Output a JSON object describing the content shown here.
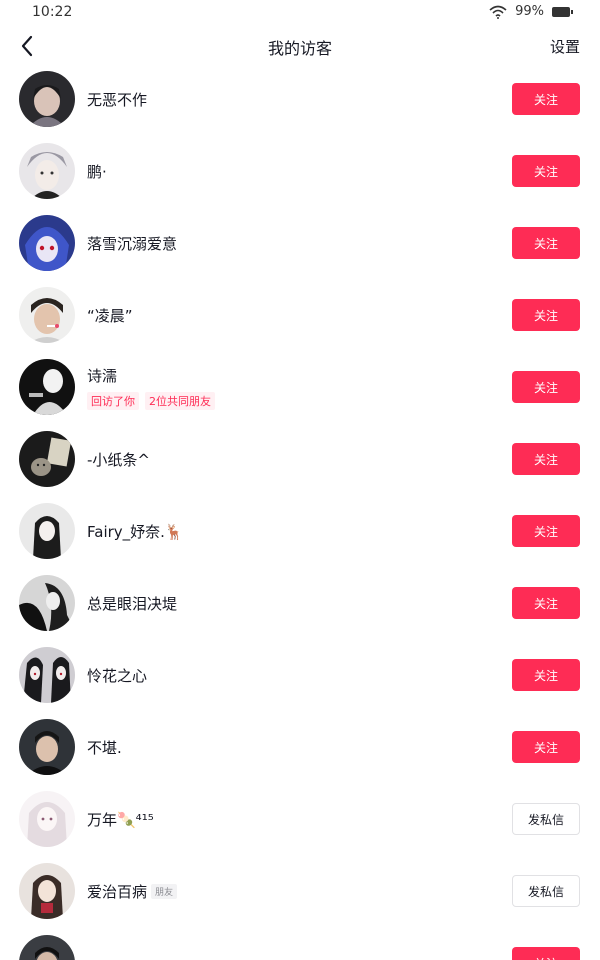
{
  "status_bar": {
    "time": "10:22",
    "battery": "99%"
  },
  "nav": {
    "title": "我的访客",
    "settings": "设置"
  },
  "colors": {
    "accent": "#fe2c55"
  },
  "visitors": [
    {
      "name": "无恶不作",
      "action": "关注",
      "action_type": "follow"
    },
    {
      "name": "鹏·",
      "action": "关注",
      "action_type": "follow"
    },
    {
      "name": "落雪沉溺爱意",
      "action": "关注",
      "action_type": "follow"
    },
    {
      "name": "“凌晨”",
      "action": "关注",
      "action_type": "follow"
    },
    {
      "name": "诗濡",
      "tags": [
        "回访了你",
        "2位共同朋友"
      ],
      "action": "关注",
      "action_type": "follow"
    },
    {
      "name": "-小纸条^",
      "action": "关注",
      "action_type": "follow"
    },
    {
      "name": "Fairy_妤奈.🦌",
      "action": "关注",
      "action_type": "follow"
    },
    {
      "name": "总是眼泪决堤",
      "action": "关注",
      "action_type": "follow"
    },
    {
      "name": "怜花之心",
      "action": "关注",
      "action_type": "follow"
    },
    {
      "name": "不堪.",
      "action": "关注",
      "action_type": "follow"
    },
    {
      "name": "万年🍡⁴¹⁵",
      "action": "发私信",
      "action_type": "message"
    },
    {
      "name": "爱治百病",
      "chip": "朋友",
      "action": "发私信",
      "action_type": "message"
    },
    {
      "name": "",
      "action": "关注",
      "action_type": "follow"
    }
  ]
}
